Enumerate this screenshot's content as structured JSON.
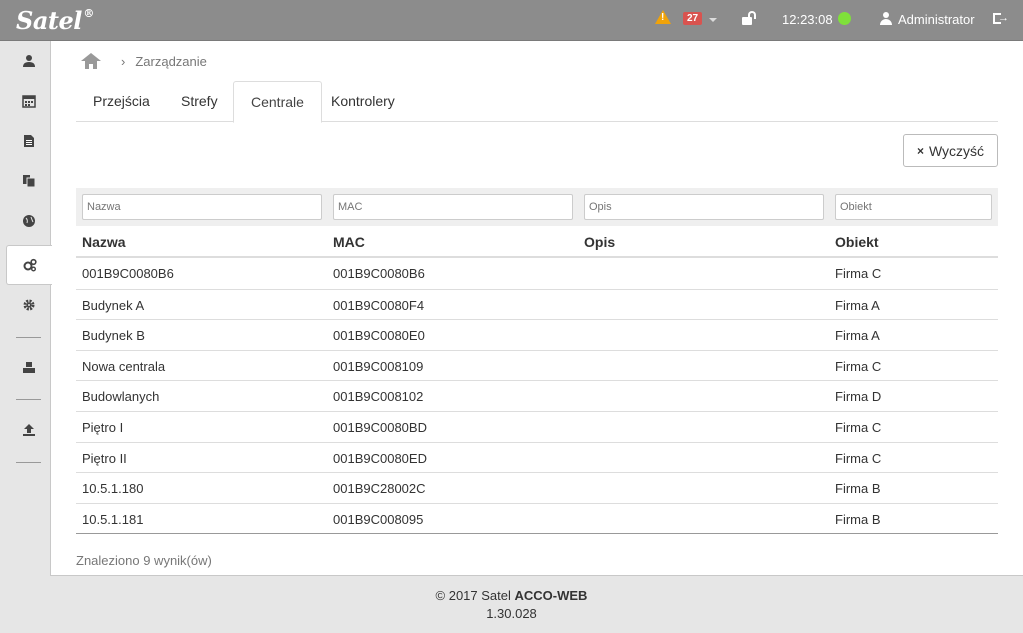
{
  "app": {
    "logo": "Satel",
    "logo_mark": "®"
  },
  "topbar": {
    "alarm_count": "27",
    "time": "12:23:08",
    "user": "Administrator"
  },
  "breadcrumb": {
    "current": "Zarządzanie",
    "separator": "›"
  },
  "tabs": [
    {
      "label": "Przejścia"
    },
    {
      "label": "Strefy"
    },
    {
      "label": "Centrale"
    },
    {
      "label": "Kontrolery"
    }
  ],
  "toolbar": {
    "clear_label": "Wyczyść",
    "clear_icon": "×"
  },
  "filters": {
    "name": "Nazwa",
    "mac": "MAC",
    "desc": "Opis",
    "object": "Obiekt"
  },
  "table": {
    "headers": [
      "Nazwa",
      "MAC",
      "Opis",
      "Obiekt"
    ],
    "rows": [
      [
        "001B9C0080B6",
        "001B9C0080B6",
        "",
        "Firma C"
      ],
      [
        "Budynek A",
        "001B9C0080F4",
        "",
        "Firma A"
      ],
      [
        "Budynek B",
        "001B9C0080E0",
        "",
        "Firma A"
      ],
      [
        "Nowa centrala",
        "001B9C008109",
        "",
        "Firma C"
      ],
      [
        "Budowlanych",
        "001B9C008102",
        "",
        "Firma D"
      ],
      [
        "Piętro I",
        "001B9C0080BD",
        "",
        "Firma C"
      ],
      [
        "Piętro II",
        "001B9C0080ED",
        "",
        "Firma C"
      ],
      [
        "10.5.1.180",
        "001B9C28002C",
        "",
        "Firma B"
      ],
      [
        "10.5.1.181",
        "001B9C008095",
        "",
        "Firma B"
      ]
    ]
  },
  "results": "Znaleziono 9 wynik(ów)",
  "footer": {
    "copyright": "© 2017 Satel",
    "product": "ACCO-WEB",
    "version": "1.30.028"
  },
  "colors": {
    "topbar": "#8c8c8c",
    "status_ok": "#7fe03a",
    "badge": "#d9534f",
    "warning": "#f0a30a"
  }
}
